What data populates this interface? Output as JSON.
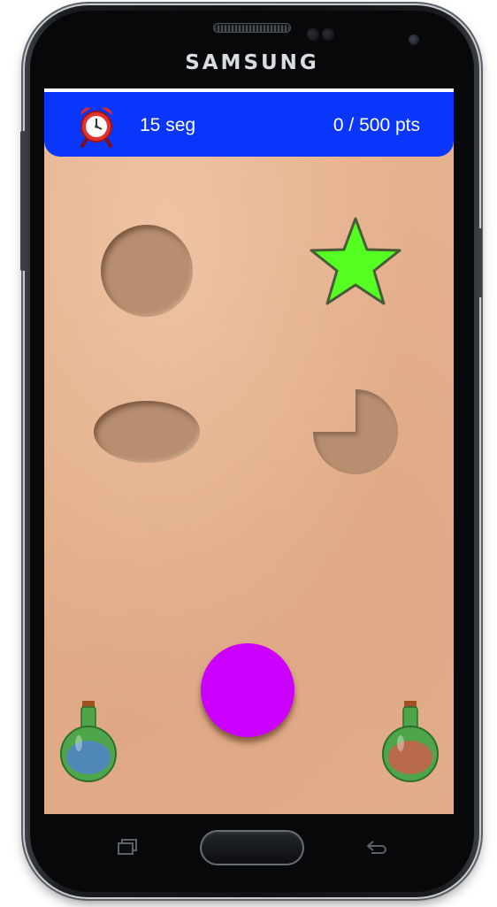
{
  "device": {
    "brand": "SAMSUNG"
  },
  "game": {
    "timer": "15 seg",
    "score": "0 / 500 pts",
    "timer_icon": "alarm-clock-icon",
    "colors": {
      "topbar": "#0a35fa",
      "board": "#e5b08d",
      "slot": "#b88e71",
      "star": "#55ff22",
      "ball": "#cc00ff",
      "potion_glass": "#4fa64a",
      "potion_left_liquid": "#4f88b8",
      "potion_right_liquid": "#b86a4a"
    },
    "shapes": [
      {
        "name": "circle-slot"
      },
      {
        "name": "star-piece"
      },
      {
        "name": "ellipse-slot"
      },
      {
        "name": "pacman-slot"
      },
      {
        "name": "draggable-ball"
      },
      {
        "name": "potion-left"
      },
      {
        "name": "potion-right"
      }
    ]
  },
  "navigation": {
    "recent_icon": "recent-apps-icon",
    "home_icon": "home-button",
    "back_icon": "back-arrow-icon"
  }
}
